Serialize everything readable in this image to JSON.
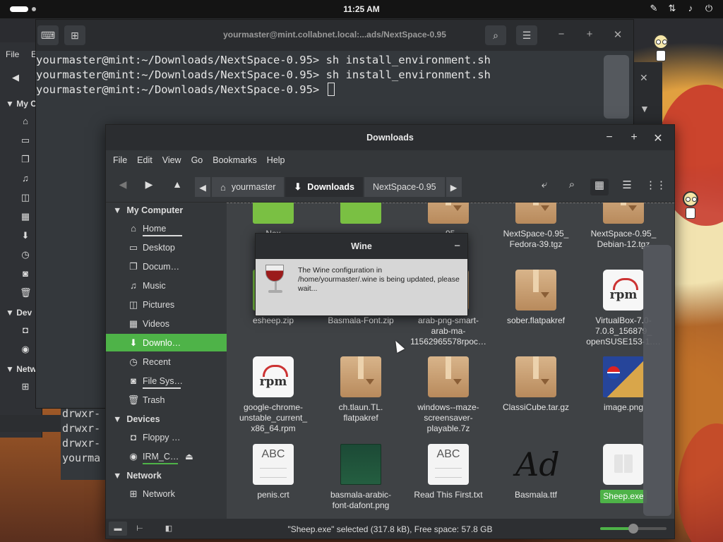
{
  "top_panel": {
    "clock": "11:25 AM",
    "tray_icons": [
      "pen-icon",
      "network-icon",
      "volume-icon",
      "power-icon"
    ]
  },
  "bg_window": {
    "menu_label": "File",
    "menu_label_2": "E",
    "my_computer": "My C",
    "devices": "Dev",
    "network": "Netw"
  },
  "terminal": {
    "title": "yourmaster@mint.collabnet.local:...ads/NextSpace-0.95",
    "lines": [
      "yourmaster@mint:~/Downloads/NextSpace-0.95> sh install_environment.sh",
      "yourmaster@mint:~/Downloads/NextSpace-0.95> sh install_environment.sh",
      "yourmaster@mint:~/Downloads/NextSpace-0.95> "
    ]
  },
  "terminal2": {
    "lines": [
      "drwxr-",
      "drwxr-",
      "drwxr-",
      "yourma"
    ]
  },
  "file_manager": {
    "title": "Downloads",
    "menu": [
      "File",
      "Edit",
      "View",
      "Go",
      "Bookmarks",
      "Help"
    ],
    "breadcrumbs": [
      "yourmaster",
      "Downloads",
      "NextSpace-0.95"
    ],
    "sidebar": {
      "my_computer": "My Computer",
      "devices_header": "Devices",
      "network_header": "Network",
      "items": [
        {
          "label": "Home",
          "icon": "home-icon"
        },
        {
          "label": "Desktop",
          "icon": "desktop-icon"
        },
        {
          "label": "Docum…",
          "icon": "documents-icon"
        },
        {
          "label": "Music",
          "icon": "music-icon"
        },
        {
          "label": "Pictures",
          "icon": "pictures-icon"
        },
        {
          "label": "Videos",
          "icon": "videos-icon"
        },
        {
          "label": "Downlo…",
          "icon": "download-icon"
        },
        {
          "label": "Recent",
          "icon": "recent-icon"
        },
        {
          "label": "File Sys…",
          "icon": "filesystem-icon"
        },
        {
          "label": "Trash",
          "icon": "trash-icon"
        }
      ],
      "devices": [
        {
          "label": "Floppy …",
          "icon": "floppy-icon"
        },
        {
          "label": "IRM_C…",
          "icon": "disc-icon"
        }
      ],
      "network": [
        {
          "label": "Network",
          "icon": "network-icon"
        }
      ]
    },
    "files": [
      {
        "name": "Nex",
        "type": "zip"
      },
      {
        "name": "",
        "type": "zip"
      },
      {
        "name": "…95_\n…gz",
        "type": "pkg"
      },
      {
        "name": "NextSpace-0.95_\nFedora-39.tgz",
        "type": "pkg"
      },
      {
        "name": "NextSpace-0.95_\nDebian-12.tgz",
        "type": "pkg"
      },
      {
        "name": "esheep.zip",
        "type": "zip"
      },
      {
        "name": "Basmala-Font.zip",
        "type": "zip"
      },
      {
        "name": "arab-png-smart-\narab-ma-\n11562965578rpoc…",
        "type": "pkg"
      },
      {
        "name": "sober.flatpakref",
        "type": "pkg"
      },
      {
        "name": "VirtualBox-7.0-\n7.0.8_156879_\nopenSUSE153-1.…",
        "type": "rpm"
      },
      {
        "name": "google-chrome-\nunstable_current_\nx86_64.rpm",
        "type": "rpm"
      },
      {
        "name": "ch.tlaun.TL.\nflatpakref",
        "type": "pkg"
      },
      {
        "name": "windows--maze-\nscreensaver-\nplayable.7z",
        "type": "pkg"
      },
      {
        "name": "ClassiCube.tar.gz",
        "type": "pkg"
      },
      {
        "name": "image.png",
        "type": "pepsi"
      },
      {
        "name": "penis.crt",
        "type": "abc"
      },
      {
        "name": "basmala-arabic-\nfont-dafont.png",
        "type": "greenimg"
      },
      {
        "name": "Read This First.txt",
        "type": "abc"
      },
      {
        "name": "Basmala.ttf",
        "type": "ttf"
      },
      {
        "name": "Sheep.exe",
        "type": "exe",
        "selected": true
      }
    ],
    "icon_text": {
      "rpm": "rpm",
      "abc": "ABC",
      "ttf": "Ad"
    },
    "status": "\"Sheep.exe\" selected (317.8 kB), Free space: 57.8 GB",
    "zoom_level": 0.5,
    "accent_color": "#4eb348"
  },
  "wine_dialog": {
    "title": "Wine",
    "message": "The Wine configuration in /home/yourmaster/.wine is being updated, please wait..."
  }
}
